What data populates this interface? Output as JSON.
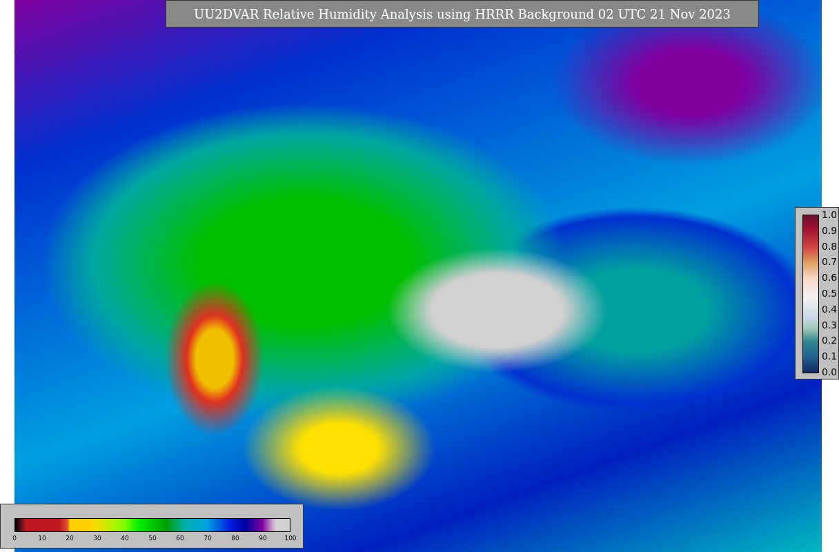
{
  "title": "UU2DVAR Relative Humidity Analysis using HRRR Background 02 UTC 21 Nov 2023",
  "weight_legend": {
    "ticks": [
      "1.0",
      "0.9",
      "0.8",
      "0.7",
      "0.6",
      "0.5",
      "0.4",
      "0.3",
      "0.2",
      "0.1",
      "0.0"
    ]
  },
  "humidity_legend": {
    "ticks": [
      "0",
      "10",
      "20",
      "30",
      "40",
      "50",
      "60",
      "70",
      "80",
      "90",
      "100"
    ]
  }
}
